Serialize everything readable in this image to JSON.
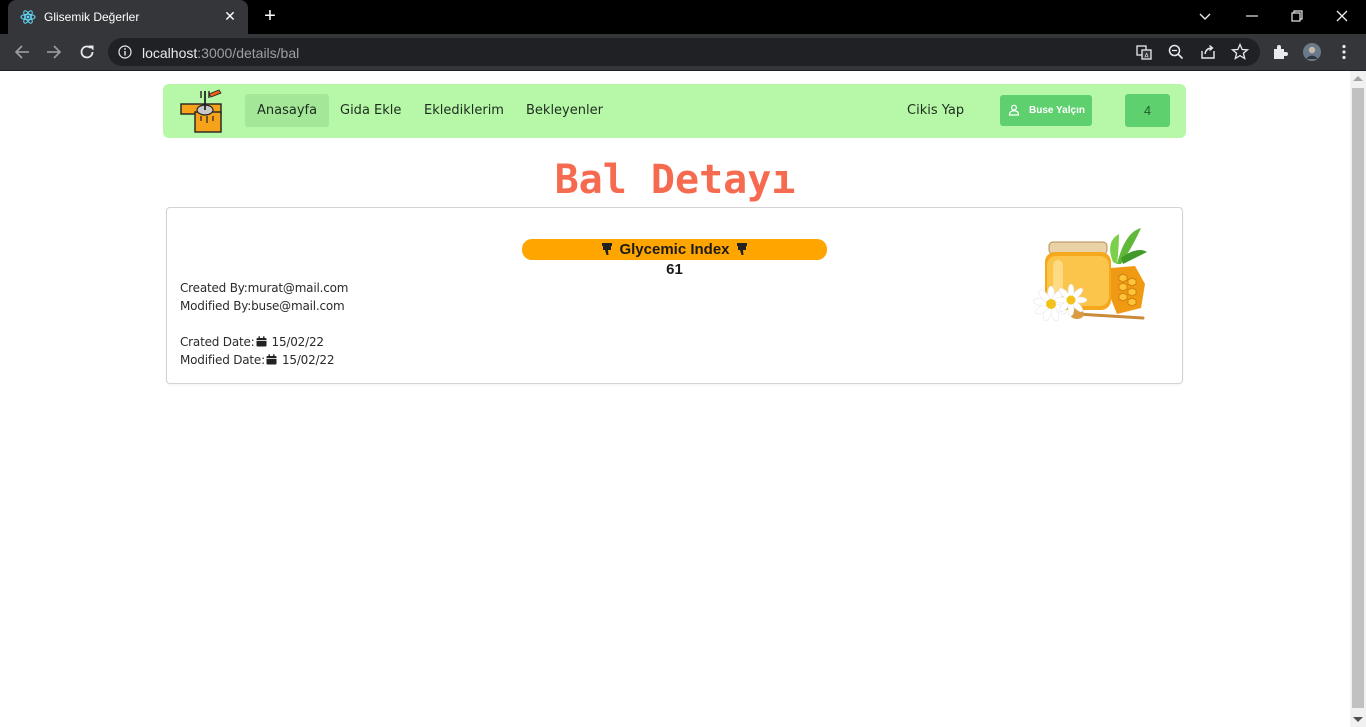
{
  "browser": {
    "tab_title": "Glisemik Değerler",
    "url_host": "localhost",
    "url_path": ":3000/details/bal"
  },
  "navbar": {
    "items": [
      {
        "label": "Anasayfa",
        "active": true
      },
      {
        "label": "Gida Ekle",
        "active": false
      },
      {
        "label": "Eklediklerim",
        "active": false
      },
      {
        "label": "Bekleyenler",
        "active": false
      }
    ],
    "logout_label": "Cikis Yap",
    "user_label": "Buse Yalçın",
    "count": "4"
  },
  "page": {
    "title": "Bal Detayı"
  },
  "detail": {
    "gi_label": "Glycemic Index",
    "gi_value": "61",
    "created_by": "Created By:murat@mail.com",
    "modified_by": "Modified By:buse@mail.com",
    "created_date_label": "Crated Date:",
    "created_date": "15/02/22",
    "modified_date_label": "Modified Date:",
    "modified_date": "15/02/22"
  },
  "colors": {
    "navbar_bg": "#b7f8a8",
    "accent_green": "#5ed06e",
    "title_color": "#f66b4f",
    "gi_pill": "#ffa500"
  }
}
